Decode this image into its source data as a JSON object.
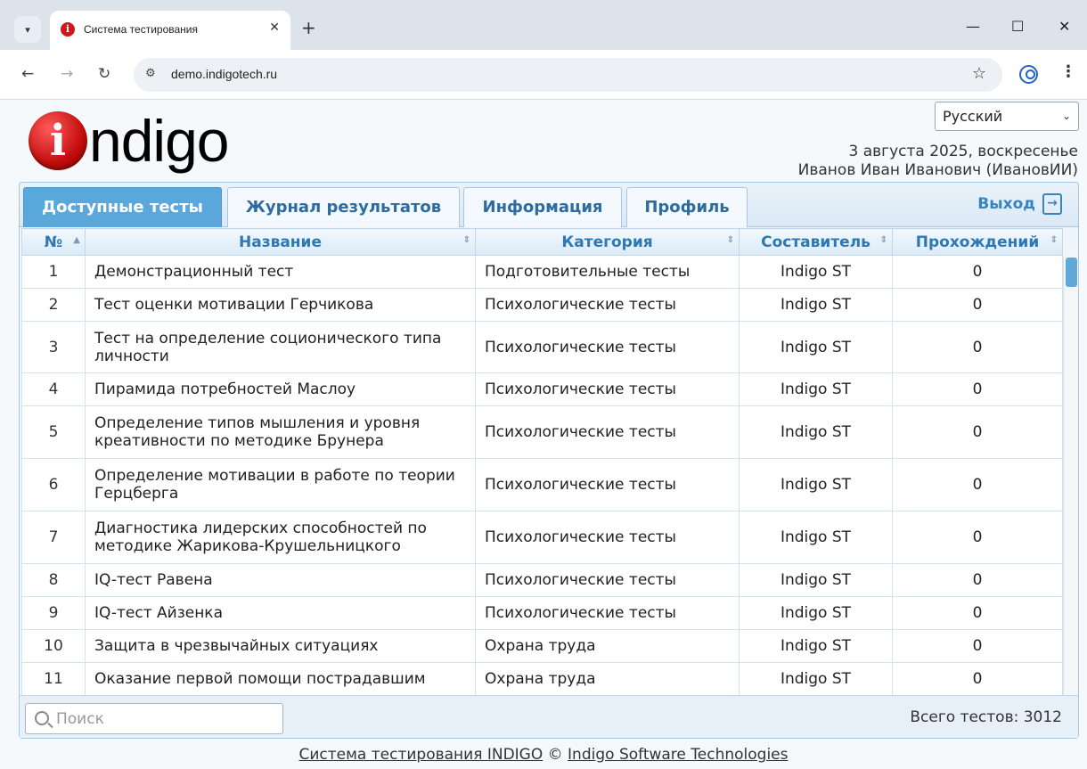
{
  "browser": {
    "tab_title": "Система тестирования",
    "tab_favicon": "i",
    "url": "demo.indigotech.ru",
    "accent": "#2563c9"
  },
  "header": {
    "logo_letter": "i",
    "logo_text": "ndigo",
    "language": "Русский",
    "date": "3 августа 2025, воскресенье",
    "user": "Иванов Иван Иванович (ИвановИИ)"
  },
  "tabs": [
    {
      "label": "Доступные тесты",
      "active": true
    },
    {
      "label": "Журнал результатов",
      "active": false
    },
    {
      "label": "Информация",
      "active": false
    },
    {
      "label": "Профиль",
      "active": false
    }
  ],
  "logout_label": "Выход",
  "table": {
    "headers": [
      "№",
      "Название",
      "Категория",
      "Составитель",
      "Прохождений"
    ],
    "rows": [
      {
        "n": "1",
        "name": "Демонстрационный тест",
        "category": "Подготовительные тесты",
        "author": "Indigo ST",
        "passes": "0"
      },
      {
        "n": "2",
        "name": "Тест оценки мотивации Герчикова",
        "category": "Психологические тесты",
        "author": "Indigo ST",
        "passes": "0"
      },
      {
        "n": "3",
        "name": "Тест на определение соционического типа личности",
        "category": "Психологические тесты",
        "author": "Indigo ST",
        "passes": "0"
      },
      {
        "n": "4",
        "name": "Пирамида потребностей Маслоу",
        "category": "Психологические тесты",
        "author": "Indigo ST",
        "passes": "0"
      },
      {
        "n": "5",
        "name": "Определение типов мышления и уровня креативности по методике Брунера",
        "category": "Психологические тесты",
        "author": "Indigo ST",
        "passes": "0"
      },
      {
        "n": "6",
        "name": "Определение мотивации в работе по теории Герцберга",
        "category": "Психологические тесты",
        "author": "Indigo ST",
        "passes": "0"
      },
      {
        "n": "7",
        "name": "Диагностика лидерских способностей по методике Жарикова-Крушельницкого",
        "category": "Психологические тесты",
        "author": "Indigo ST",
        "passes": "0"
      },
      {
        "n": "8",
        "name": "IQ-тест Равена",
        "category": "Психологические тесты",
        "author": "Indigo ST",
        "passes": "0"
      },
      {
        "n": "9",
        "name": "IQ-тест Айзенка",
        "category": "Психологические тесты",
        "author": "Indigo ST",
        "passes": "0"
      },
      {
        "n": "10",
        "name": "Защита в чрезвычайных ситуациях",
        "category": "Охрана труда",
        "author": "Indigo ST",
        "passes": "0"
      },
      {
        "n": "11",
        "name": "Оказание первой помощи пострадавшим",
        "category": "Охрана труда",
        "author": "Indigo ST",
        "passes": "0"
      }
    ]
  },
  "search": {
    "placeholder": "Поиск"
  },
  "total": "Всего тестов: 3012",
  "footer": {
    "link1": "Система тестирования INDIGO",
    "copyright": "©",
    "link2": "Indigo Software Technologies"
  }
}
